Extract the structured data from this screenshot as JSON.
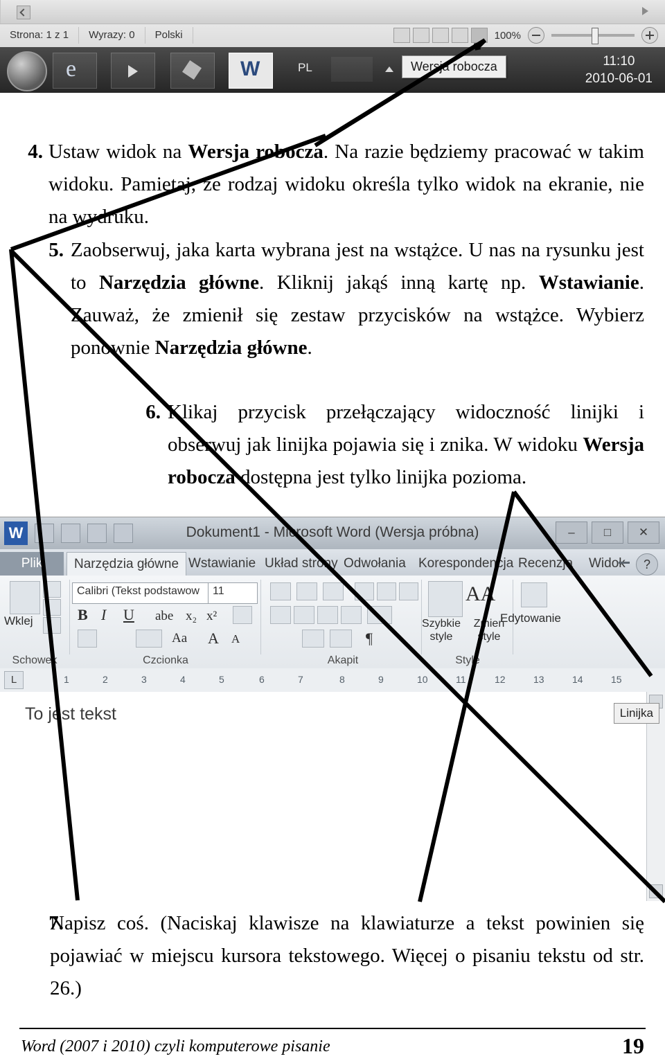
{
  "top_screenshot": {
    "status_bar": {
      "page_info": "Strona: 1 z 1",
      "word_count": "Wyrazy: 0",
      "language": "Polski",
      "zoom_value": "100%"
    },
    "taskbar": {
      "language_indicator": "PL",
      "tooltip": "Wersja robocza",
      "clock_time": "11:10",
      "clock_date": "2010-06-01"
    }
  },
  "steps": [
    {
      "number": "4.",
      "text_html": "Ustaw widok na <b>Wersja robocza</b>. Na razie będziemy pracować w takim widoku. Pamiętaj, że rodzaj widoku określa tylko widok na ekranie, nie na wydruku."
    },
    {
      "number": "5.",
      "text_html": "Zaobserwuj, jaka karta wybrana jest na wstążce. U nas na rysunku jest to <b>Narzędzia główne</b>. Kliknij jakąś inną kartę np. <b>Wstawianie</b>. Zauważ, że zmienił się zestaw przycisków na wstążce. Wybierz ponownie <b>Narzędzia główne</b>."
    },
    {
      "number": "6.",
      "text_html": "Klikaj przycisk przełączający widoczność linijki i obserwuj jak linijka pojawia się i znika. W widoku <b>Wersja robocza</b> dostępna jest tylko linijka pozioma."
    },
    {
      "number": "7.",
      "text_html": "Napisz coś. (Naciskaj klawisze na klawiaturze a tekst powinien się pojawiać w miejscu kursora tekstowego. Więcej o pisaniu tekstu od str. 26.)"
    }
  ],
  "word_screenshot": {
    "title": "Dokument1 - Microsoft Word (Wersja próbna)",
    "window_buttons": [
      "–",
      "□",
      "✕"
    ],
    "tabs": [
      "Plik",
      "Narzędzia główne",
      "Wstawianie",
      "Układ strony",
      "Odwołania",
      "Korespondencja",
      "Recenzja",
      "Widok"
    ],
    "active_tab": "Narzędzia główne",
    "font_name": "Calibri (Tekst podstawow",
    "font_size": "11",
    "group_labels": [
      "Schowek",
      "Czcionka",
      "Akapit",
      "Style"
    ],
    "buttons": {
      "paste": "Wklej",
      "styles_quick": "Szybkie style",
      "styles_change": "Zmień style",
      "editing": "Edytowanie"
    },
    "ruler_ticks": [
      "1",
      "2",
      "3",
      "4",
      "5",
      "6",
      "7",
      "8",
      "9",
      "10",
      "11",
      "12",
      "13",
      "14",
      "15"
    ],
    "ruler_corner": "L",
    "document_text": "To jest tekst",
    "ruler_tooltip": "Linijka"
  },
  "footer": {
    "text": "Word (2007 i 2010) czyli komputerowe pisanie",
    "page_number": "19"
  }
}
